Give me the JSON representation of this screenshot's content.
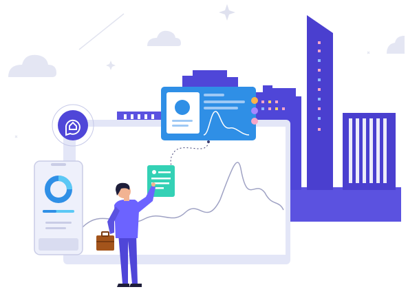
{
  "illustration": {
    "subject": "businessman-analytics-dashboard",
    "icons": [
      "home-chat-icon",
      "donut-chart-icon",
      "profile-card-icon",
      "document-icon",
      "briefcase-icon",
      "sparkle-icon"
    ]
  },
  "colors": {
    "brand": "#4f46d8",
    "brand_light": "#6c63ff",
    "building_dark": "#4a3fcf",
    "building_mid": "#5b52e0",
    "accent_blue": "#2f8fe6",
    "accent_teal": "#34d1b5",
    "accent_cyan": "#5bc8f5",
    "panel_bg": "#eef0fb",
    "cloud": "#e4e6f3",
    "curve": "#9fa2c4"
  }
}
